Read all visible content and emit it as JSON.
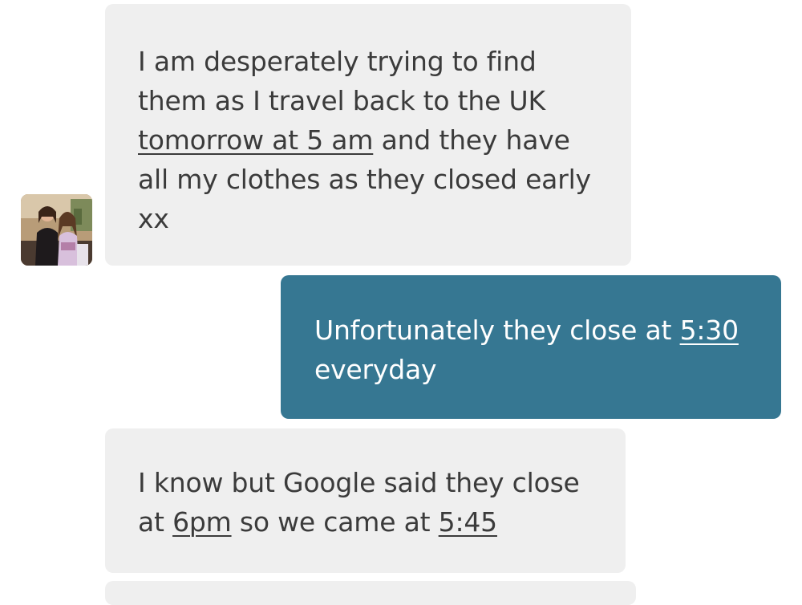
{
  "messages": [
    {
      "direction": "received",
      "segments": [
        {
          "text": "I am desperately trying to find them as I travel back to the UK ",
          "underline": false
        },
        {
          "text": "tomorrow at 5 am",
          "underline": true
        },
        {
          "text": " and they have all my clothes as they closed early xx",
          "underline": false
        }
      ]
    },
    {
      "direction": "sent",
      "segments": [
        {
          "text": "Unfortunately they close at ",
          "underline": false
        },
        {
          "text": "5:30",
          "underline": true
        },
        {
          "text": " everyday",
          "underline": false
        }
      ]
    },
    {
      "direction": "received",
      "segments": [
        {
          "text": "I know but Google said they close at ",
          "underline": false
        },
        {
          "text": "6pm",
          "underline": true
        },
        {
          "text": " so we came at ",
          "underline": false
        },
        {
          "text": "5:45",
          "underline": true
        }
      ]
    }
  ],
  "contact": {
    "avatar_icon": "avatar-photo-icon"
  },
  "colors": {
    "received_bubble": "#efefef",
    "received_text": "#3b3b3b",
    "sent_bubble": "#367792",
    "sent_text": "#ffffff"
  }
}
